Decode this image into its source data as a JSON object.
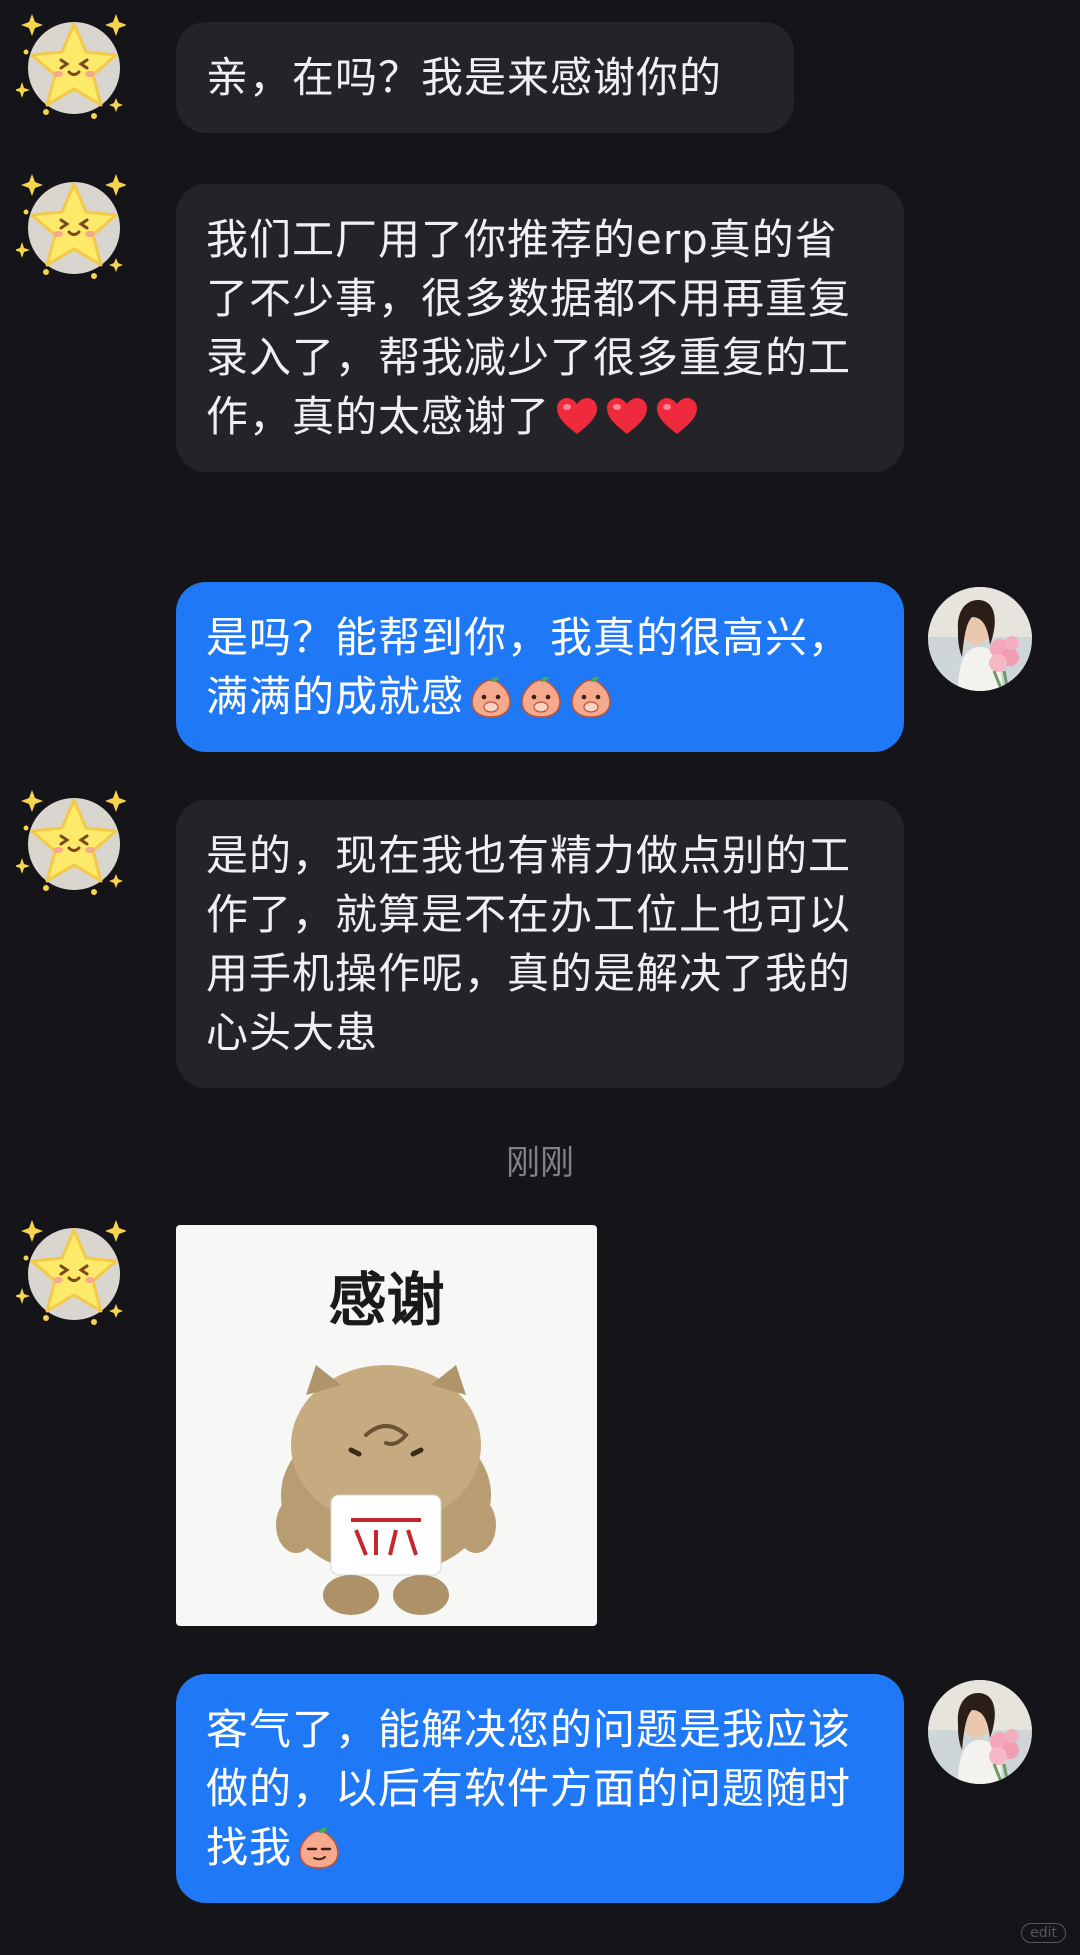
{
  "messages": [
    {
      "id": "m1",
      "side": "in",
      "text": "亲，在吗？我是来感谢你的",
      "emojis": []
    },
    {
      "id": "m2",
      "side": "in",
      "text": "我们工厂用了你推荐的erp真的省了不少事，很多数据都不用再重复录入了，帮我减少了很多重复的工作，真的太感谢了",
      "emojis": [
        "heart-emoji",
        "heart-emoji",
        "heart-emoji"
      ]
    },
    {
      "id": "m3",
      "side": "out",
      "text": "是吗？能帮到你，我真的很高兴，满满的成就感",
      "emojis": [
        "peach-cover-mouth-emoji",
        "peach-cover-mouth-emoji",
        "peach-cover-mouth-emoji"
      ]
    },
    {
      "id": "m4",
      "side": "in",
      "text": "是的，现在我也有精力做点别的工作了，就算是不在办工位上也可以用手机操作呢，真的是解决了我的心头大患",
      "emojis": []
    },
    {
      "id": "m5",
      "side": "out",
      "text": "客气了，能解决您的问题是我应该做的，以后有软件方面的问题随时找我",
      "emojis": [
        "peach-smug-emoji"
      ]
    }
  ],
  "timestamp": "刚刚",
  "sticker": {
    "caption": "感谢",
    "subject": "plush-bear-sticker"
  },
  "watermark": "edit",
  "colors": {
    "background": "#151519",
    "incoming_bubble": "#232328",
    "outgoing_bubble": "#1f78f5",
    "timestamp": "#7f8088"
  }
}
